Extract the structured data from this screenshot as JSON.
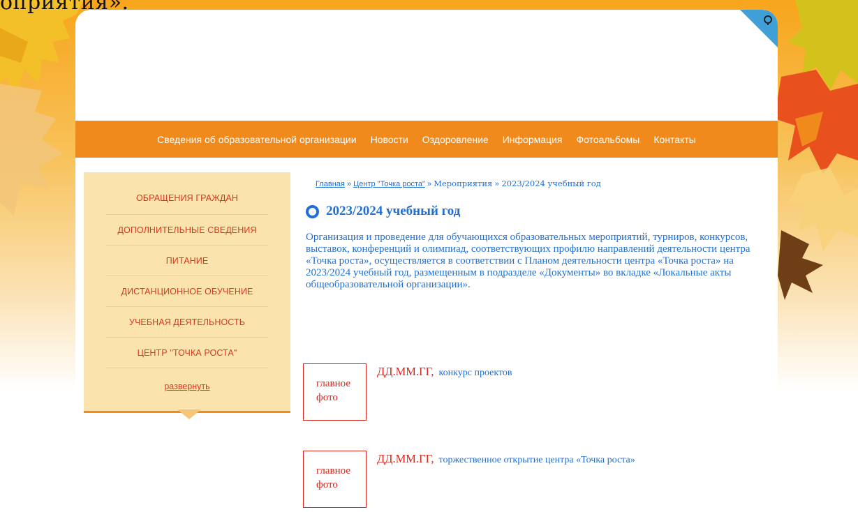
{
  "header": {
    "caption_fragment": "оприятия»."
  },
  "nav": {
    "items": [
      "Сведения об образовательной организации",
      "Новости",
      "Оздоровление",
      "Информация",
      "Фотоальбомы",
      "Контакты"
    ]
  },
  "sidebar": {
    "items": [
      "ОБРАЩЕНИЯ ГРАЖДАН",
      "ДОПОЛНИТЕЛЬНЫЕ СВЕДЕНИЯ",
      "ПИТАНИЕ",
      "ДИСТАНЦИОННОЕ ОБУЧЕНИЕ",
      "УЧЕБНАЯ ДЕЯТЕЛЬНОСТЬ",
      "ЦЕНТР \"ТОЧКА РОСТА\""
    ],
    "expand_label": "развернуть"
  },
  "breadcrumb": {
    "home": "Главная",
    "sep": "»",
    "center": "Центр \"Точка роста\"",
    "events": "Мероприятия",
    "current": "2023/2024 учебный год"
  },
  "main": {
    "title": "2023/2024 учебный год",
    "lead": "Организация и проведение для обучающихся образовательных мероприятий, турниров, конкурсов, выставок, конференций и олимпиад, соответствующих профилю направлений деятельности центра «Точка роста», осуществляется в соответствии с Планом деятельности центра «Точка роста» на 2023/2024 учебный год, размещенным в подразделе «Документы» во вкладке «Локальные акты общеобразовательной организации».",
    "events": [
      {
        "photo_label": "главное фото",
        "date": "ДД.ММ.ГГ,",
        "name": "конкурс проектов"
      },
      {
        "photo_label": "главное фото",
        "date": "ДД.ММ.ГГ,",
        "name": "торжественное открытие центра «Точка роста»"
      }
    ]
  },
  "colors": {
    "accent_orange": "#f08a1c",
    "sidebar_bg": "#fae3ad",
    "link_blue": "#1f6fd4",
    "red": "#d9251c"
  },
  "icons": {
    "corner": "help-icon",
    "title_bullet": "circle-bullet-icon"
  }
}
